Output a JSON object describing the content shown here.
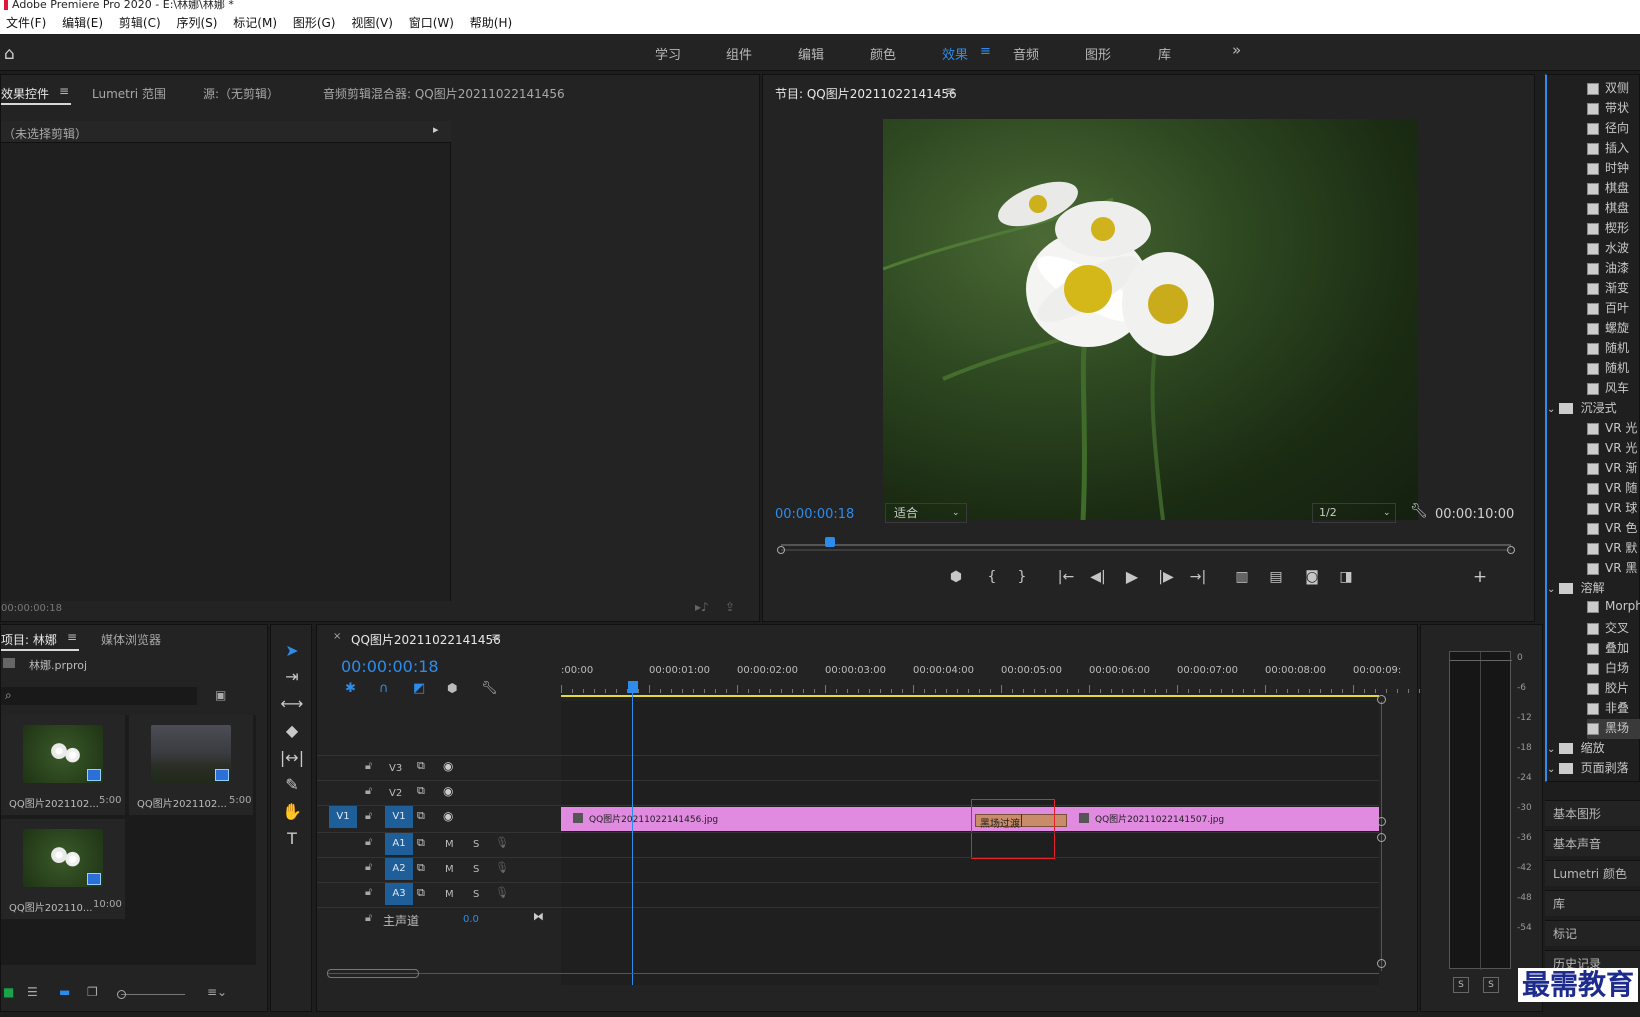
{
  "window": {
    "title": "Adobe Premiere Pro 2020 - E:\\林娜\\林娜 *"
  },
  "menu": [
    "文件(F)",
    "编辑(E)",
    "剪辑(C)",
    "序列(S)",
    "标记(M)",
    "图形(G)",
    "视图(V)",
    "窗口(W)",
    "帮助(H)"
  ],
  "workspaces": {
    "items": [
      "学习",
      "组件",
      "编辑",
      "颜色",
      "效果",
      "音频",
      "图形",
      "库"
    ],
    "active": "效果",
    "more": "»"
  },
  "effect_controls": {
    "tabs": [
      "效果控件",
      "Lumetri 范围",
      "源:（无剪辑）",
      "音频剪辑混合器: QQ图片20211022141456"
    ],
    "no_clip": "（未选择剪辑）",
    "timecode": "00:00:00:18"
  },
  "program": {
    "title": "节目: QQ图片20211022141456",
    "timecode": "00:00:00:18",
    "fit": "适合",
    "resolution": "1/2",
    "duration": "00:00:10:00"
  },
  "project": {
    "tabs": [
      "项目: 林娜",
      "媒体浏览器"
    ],
    "file": "林娜.prproj",
    "items": [
      {
        "name": "QQ图片2021102...",
        "dur": "5:00"
      },
      {
        "name": "QQ图片2021102...",
        "dur": "5:00"
      },
      {
        "name": "QQ图片202110...",
        "dur": "10:00"
      }
    ]
  },
  "timeline": {
    "tab": "QQ图片20211022141456",
    "timecode": "00:00:00:18",
    "ruler": [
      ":00:00",
      "00:00:01:00",
      "00:00:02:00",
      "00:00:03:00",
      "00:00:04:00",
      "00:00:05:00",
      "00:00:06:00",
      "00:00:07:00",
      "00:00:08:00",
      "00:00:09:"
    ],
    "video_tracks": [
      "V3",
      "V2",
      "V1"
    ],
    "audio_tracks": [
      "A1",
      "A2",
      "A3"
    ],
    "src_patch": "V1",
    "master": {
      "label": "主声道",
      "value": "0.0"
    },
    "mute": "M",
    "solo": "S",
    "clips": {
      "clip1": "QQ图片20211022141456.jpg",
      "clip2": "QQ图片20211022141507.jpg",
      "transition": "黑场过渡"
    }
  },
  "audio_meter": {
    "scale": [
      "0",
      "-6",
      "-12",
      "-18",
      "-24",
      "-30",
      "-36",
      "-42",
      "-48",
      "-54"
    ],
    "solo": [
      "S",
      "S"
    ]
  },
  "effects_list": {
    "items": [
      {
        "type": "chk",
        "label": "双侧"
      },
      {
        "type": "chk",
        "label": "带状"
      },
      {
        "type": "chk",
        "label": "径向"
      },
      {
        "type": "chk",
        "label": "插入"
      },
      {
        "type": "chk",
        "label": "时钟"
      },
      {
        "type": "chk",
        "label": "棋盘"
      },
      {
        "type": "chk",
        "label": "棋盘"
      },
      {
        "type": "chk",
        "label": "楔形"
      },
      {
        "type": "chk",
        "label": "水波"
      },
      {
        "type": "chk",
        "label": "油漆"
      },
      {
        "type": "chk",
        "label": "渐变"
      },
      {
        "type": "chk",
        "label": "百叶"
      },
      {
        "type": "chk",
        "label": "螺旋"
      },
      {
        "type": "chk",
        "label": "随机"
      },
      {
        "type": "chk",
        "label": "随机"
      },
      {
        "type": "chk",
        "label": "风车"
      },
      {
        "type": "folder",
        "label": "沉浸式"
      },
      {
        "type": "chk",
        "label": "VR 光"
      },
      {
        "type": "chk",
        "label": "VR 光"
      },
      {
        "type": "chk",
        "label": "VR 渐"
      },
      {
        "type": "chk",
        "label": "VR 随"
      },
      {
        "type": "chk",
        "label": "VR 球"
      },
      {
        "type": "chk",
        "label": "VR 色"
      },
      {
        "type": "chk",
        "label": "VR 默"
      },
      {
        "type": "chk",
        "label": "VR 黑"
      },
      {
        "type": "folder",
        "label": "溶解"
      },
      {
        "type": "chk",
        "label": "Morph"
      },
      {
        "type": "chk",
        "label": "交叉"
      },
      {
        "type": "chk",
        "label": "叠加"
      },
      {
        "type": "chk",
        "label": "白场"
      },
      {
        "type": "chk",
        "label": "胶片"
      },
      {
        "type": "chk",
        "label": "非叠"
      },
      {
        "type": "chk",
        "label": "黑场"
      },
      {
        "type": "folder",
        "label": "缩放"
      },
      {
        "type": "folder",
        "label": "页面剥落"
      }
    ],
    "selected_index": 32
  },
  "side_panels": [
    "基本图形",
    "基本声音",
    "Lumetri 颜色",
    "库",
    "标记",
    "历史记录"
  ],
  "watermark": "最需教育",
  "colors": {
    "accent": "#2d8ceb",
    "clip": "#e08be0",
    "transition": "#c98c6a",
    "highlight": "#e8222a",
    "track_sel": "#1e5e99"
  }
}
